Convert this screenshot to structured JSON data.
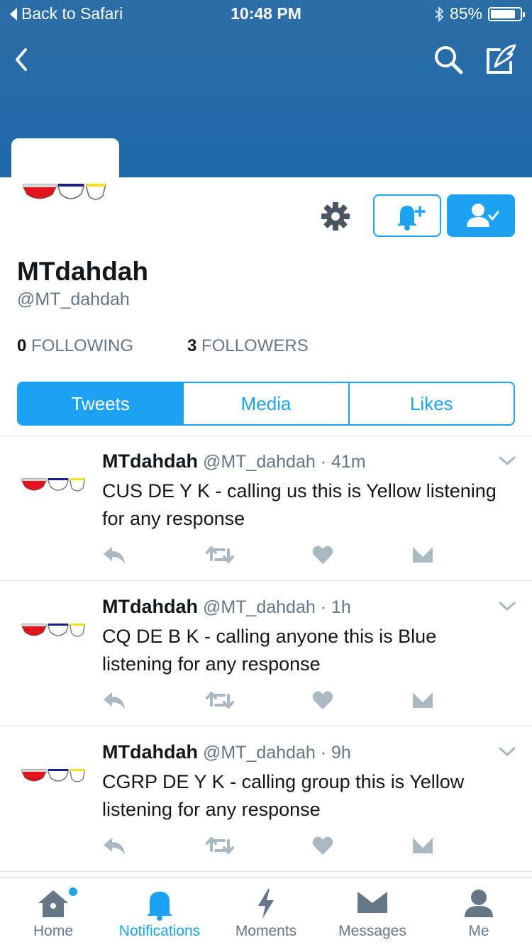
{
  "status_bar": {
    "back_label": "Back to Safari",
    "time": "10:48 PM",
    "battery_text": "85%",
    "battery_level": 0.85
  },
  "colors": {
    "accent": "#1da1f2",
    "banner": "#256ca9",
    "muted": "#657786",
    "bowl_red": "#e0141e",
    "bowl_blue": "#1b1f8a",
    "bowl_yellow": "#f4e21f"
  },
  "profile": {
    "display_name": "MTdahdah",
    "handle": "@MT_dahdah",
    "following_count": "0",
    "following_label": "FOLLOWING",
    "followers_count": "3",
    "followers_label": "FOLLOWERS"
  },
  "tabs": [
    {
      "label": "Tweets",
      "active": true
    },
    {
      "label": "Media",
      "active": false
    },
    {
      "label": "Likes",
      "active": false
    }
  ],
  "tweets": [
    {
      "name": "MTdahdah",
      "handle": "@MT_dahdah",
      "time": "41m",
      "text": "CUS DE Y K - calling us this is Yellow listening for any response"
    },
    {
      "name": "MTdahdah",
      "handle": "@MT_dahdah",
      "time": "1h",
      "text": "CQ DE B K - calling anyone this is Blue listening for any response"
    },
    {
      "name": "MTdahdah",
      "handle": "@MT_dahdah",
      "time": "9h",
      "text": "CGRP DE Y K - calling group this is Yellow listening for any response"
    }
  ],
  "tabbar": [
    {
      "label": "Home",
      "icon": "home-icon",
      "active": false,
      "badge": true
    },
    {
      "label": "Notifications",
      "icon": "bell-icon",
      "active": true,
      "badge": false
    },
    {
      "label": "Moments",
      "icon": "lightning-icon",
      "active": false,
      "badge": false
    },
    {
      "label": "Messages",
      "icon": "envelope-icon",
      "active": false,
      "badge": false
    },
    {
      "label": "Me",
      "icon": "person-icon",
      "active": false,
      "badge": false
    }
  ]
}
